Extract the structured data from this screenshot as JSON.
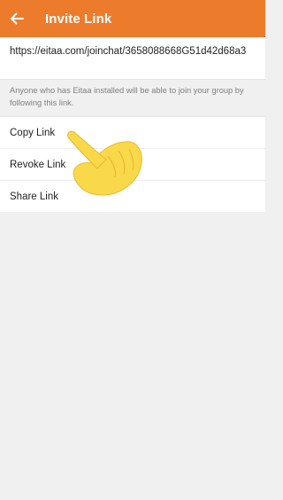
{
  "toolbar": {
    "back_icon": "arrow-left-icon",
    "title": "Invite Link",
    "color": "#ed7b2c"
  },
  "invite_link": {
    "url": "https://eitaa.com/joinchat/3658088668G51d42d68a3"
  },
  "hint": {
    "text": "Anyone who has Eitaa installed will be able to join your group by following this link."
  },
  "menu": {
    "items": [
      {
        "label": "Copy Link"
      },
      {
        "label": "Revoke Link"
      },
      {
        "label": "Share Link"
      }
    ]
  },
  "overlay": {
    "icon": "pointing-hand-icon",
    "color": "#f9d94a"
  }
}
